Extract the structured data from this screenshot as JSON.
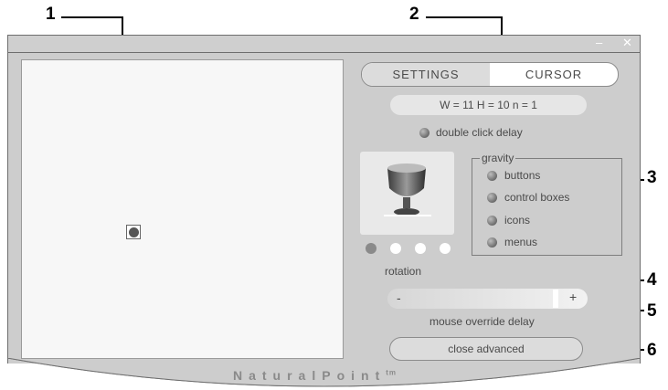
{
  "callouts": [
    "1",
    "2",
    "3",
    "4",
    "5",
    "6"
  ],
  "window": {
    "minimize_symbol": "–",
    "close_symbol": "✕"
  },
  "tabs": {
    "settings": "SETTINGS",
    "cursor": "CURSOR"
  },
  "dimensions_readout": "W = 11  H = 10  n = 1",
  "double_click_delay": "double click delay",
  "gravity": {
    "title": "gravity",
    "items": [
      "buttons",
      "control boxes",
      "icons",
      "menus"
    ]
  },
  "rotation": {
    "label": "rotation",
    "options": 4,
    "selected_index": 0
  },
  "slider": {
    "minus": "-",
    "plus": "+",
    "value_fraction": 0.9
  },
  "mouse_override_delay": "mouse override delay",
  "close_advanced": "close advanced",
  "brand": {
    "name": "NaturalPoint",
    "tm": "tm"
  },
  "colors": {
    "window": "#cdcdcd",
    "preview": "#f7f7f7",
    "led": "#7a7a7a",
    "pill": "#e6e6e6"
  }
}
